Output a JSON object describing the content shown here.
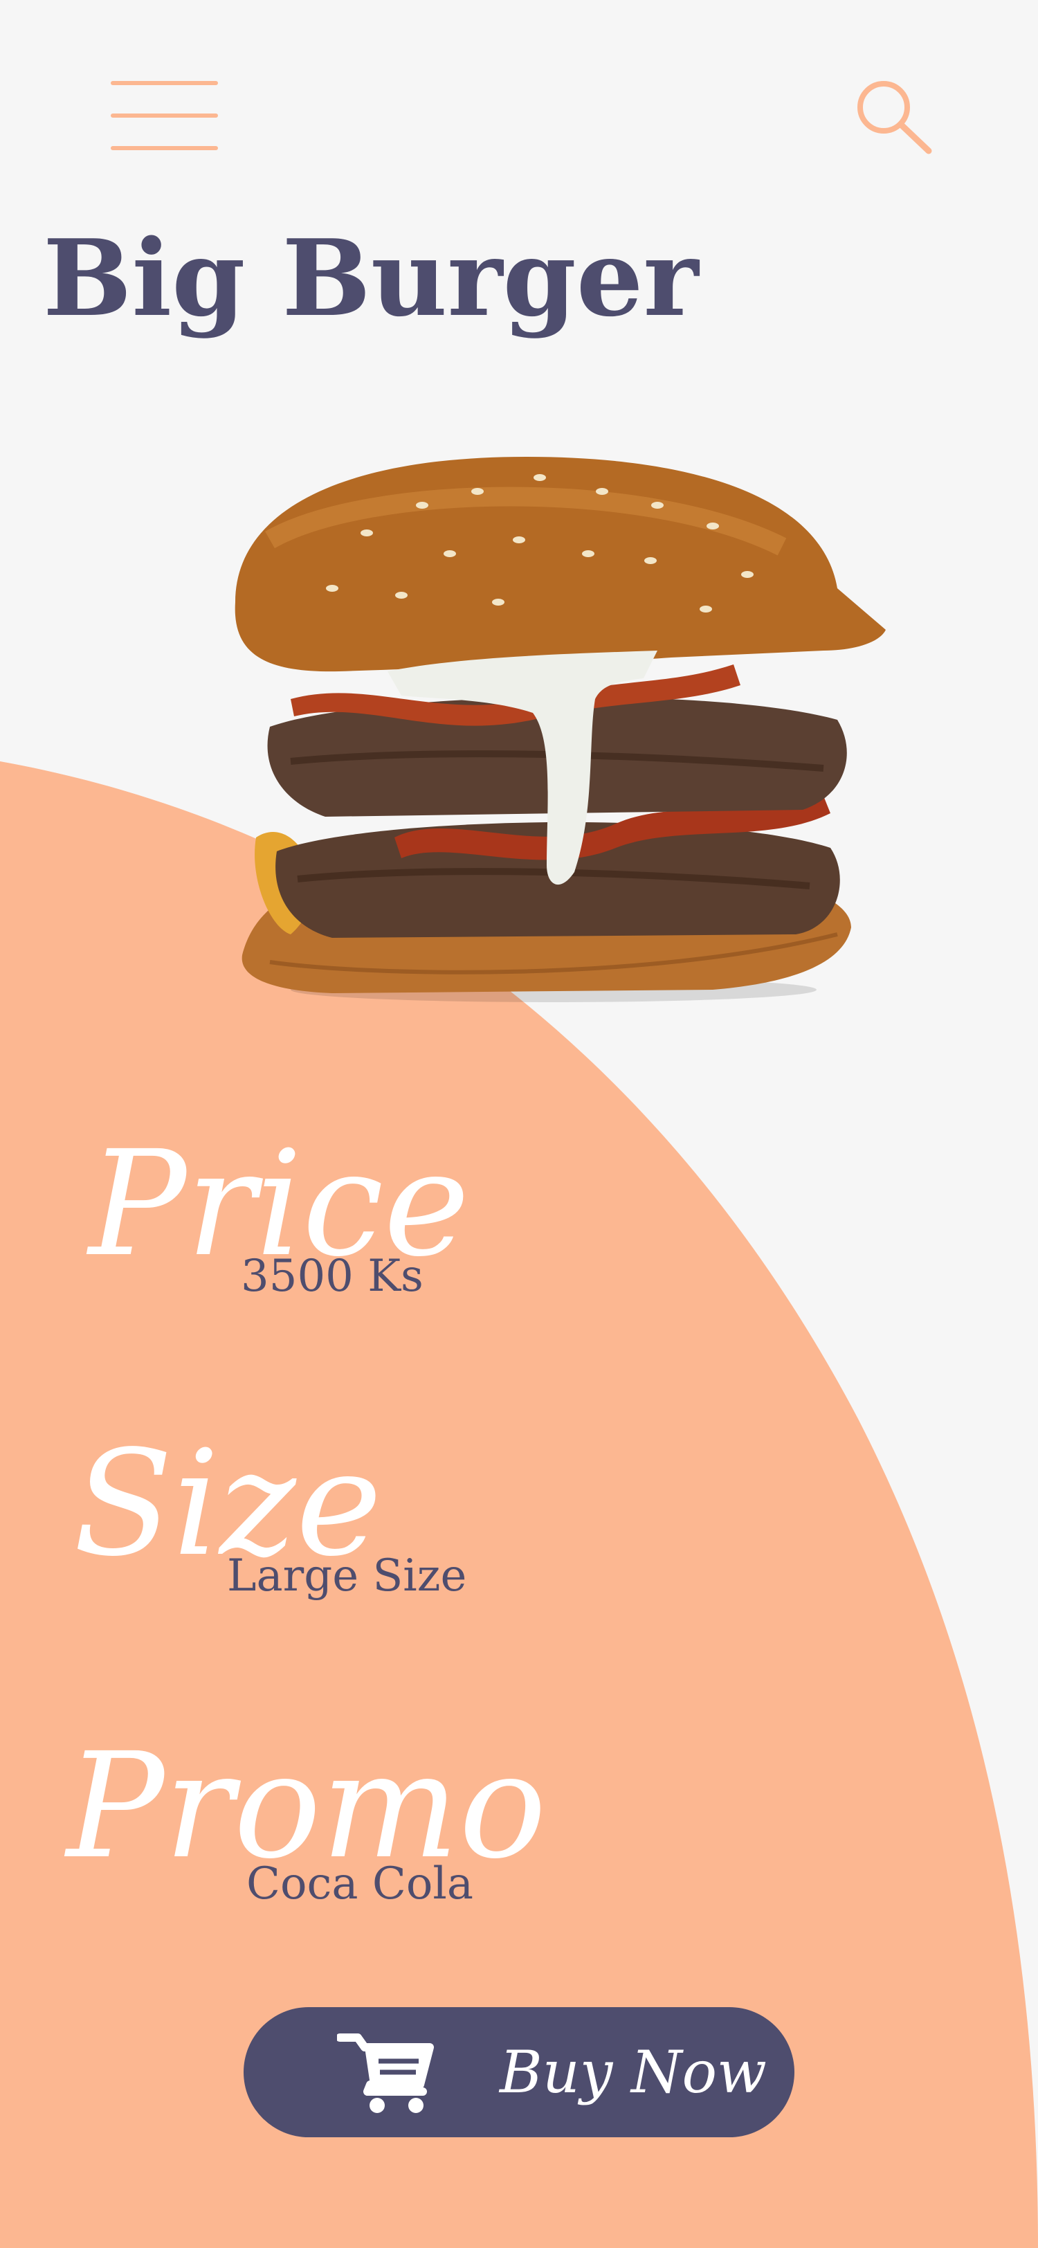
{
  "theme": {
    "background": "#f6f6f6",
    "accent": "#fcb791",
    "primary": "#4e4d6e",
    "label_text": "#ffffff"
  },
  "header": {
    "menu_icon": "hamburger-menu-icon",
    "search_icon": "search-icon"
  },
  "product": {
    "title": "Big Burger",
    "image": "burger-photo"
  },
  "details": {
    "price_label": "Price",
    "price_value": "3500 Ks",
    "size_label": "Size",
    "size_value": "Large Size",
    "promo_label": "Promo",
    "promo_value": "Coca Cola"
  },
  "action": {
    "buy_label": "Buy Now",
    "cart_icon": "shopping-cart-icon"
  }
}
